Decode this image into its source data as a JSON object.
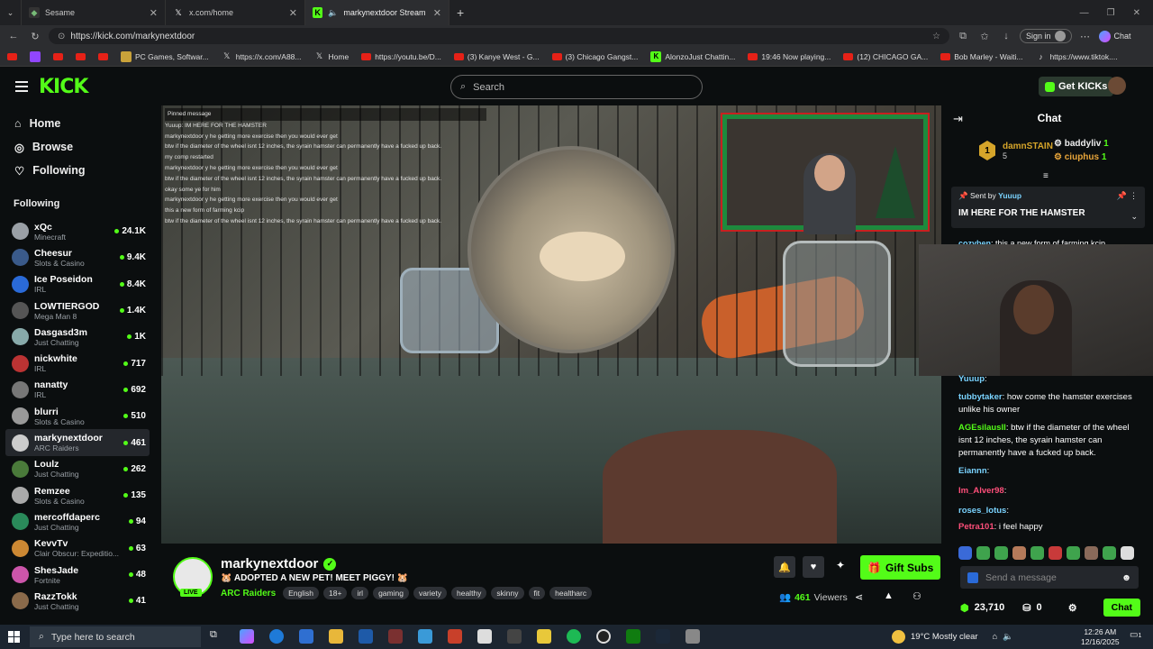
{
  "browser": {
    "tabs": [
      {
        "label": "Sesame"
      },
      {
        "label": "x.com/home"
      },
      {
        "label": "markynextdoor Stream - Wat..."
      }
    ],
    "url": "https://kick.com/markynextdoor",
    "signin_label": "Sign in",
    "copilot_label": "Chat",
    "bookmarks": [
      {
        "label": "PC Games, Softwar...",
        "icon": "game-icon"
      },
      {
        "label": "https://x.com/A88...",
        "icon": "x-icon"
      },
      {
        "label": "Home",
        "icon": "x-icon"
      },
      {
        "label": "https://youtu.be/D...",
        "icon": "youtube-icon"
      },
      {
        "label": "(3) Kanye West - G...",
        "icon": "youtube-icon"
      },
      {
        "label": "(3) Chicago Gangst...",
        "icon": "youtube-icon"
      },
      {
        "label": "AlonzoJust Chattin...",
        "icon": "kick-icon"
      },
      {
        "label": "19:46 Now playing...",
        "icon": "youtube-icon"
      },
      {
        "label": "(12) CHICAGO GA...",
        "icon": "youtube-icon"
      },
      {
        "label": "Bob Marley - Waiti...",
        "icon": "youtube-icon"
      },
      {
        "label": "https://www.tiktok....",
        "icon": "tiktok-icon"
      }
    ]
  },
  "kick": {
    "logo": "KICK",
    "search_placeholder": "Search",
    "get_kicks_label": "Get KICKs"
  },
  "sidebar": {
    "nav": [
      {
        "label": "Home",
        "icon": "home-icon"
      },
      {
        "label": "Browse",
        "icon": "compass-icon"
      },
      {
        "label": "Following",
        "icon": "heart-icon"
      }
    ],
    "following_title": "Following",
    "channels": [
      {
        "name": "xQc",
        "category": "Minecraft",
        "viewers": "24.1K",
        "color": "#9aa0a6"
      },
      {
        "name": "Cheesur",
        "category": "Slots & Casino",
        "viewers": "9.4K",
        "color": "#3a5a8a"
      },
      {
        "name": "Ice Poseidon",
        "category": "IRL",
        "viewers": "8.4K",
        "color": "#2a6ad8"
      },
      {
        "name": "LOWTIERGOD",
        "category": "Mega Man 8",
        "viewers": "1.4K",
        "color": "#555"
      },
      {
        "name": "Dasgasd3m",
        "category": "Just Chatting",
        "viewers": "1K",
        "color": "#8aa"
      },
      {
        "name": "nickwhite",
        "category": "IRL",
        "viewers": "717",
        "color": "#b33"
      },
      {
        "name": "nanatty",
        "category": "IRL",
        "viewers": "692",
        "color": "#777"
      },
      {
        "name": "blurri",
        "category": "Slots & Casino",
        "viewers": "510",
        "color": "#999"
      },
      {
        "name": "markynextdoor",
        "category": "ARC Raiders",
        "viewers": "461",
        "color": "#ccc",
        "selected": true
      },
      {
        "name": "Loulz",
        "category": "Just Chatting",
        "viewers": "262",
        "color": "#4a7a3a"
      },
      {
        "name": "Remzee",
        "category": "Slots & Casino",
        "viewers": "135",
        "color": "#aaa"
      },
      {
        "name": "mercoffdaperc",
        "category": "Just Chatting",
        "viewers": "94",
        "color": "#2a8a5a"
      },
      {
        "name": "KevvTv",
        "category": "Clair Obscur: Expeditio...",
        "viewers": "63",
        "color": "#c83"
      },
      {
        "name": "ShesJade",
        "category": "Fortnite",
        "viewers": "48",
        "color": "#c5a"
      },
      {
        "name": "RazzTokk",
        "category": "Just Chatting",
        "viewers": "41",
        "color": "#8a6a4a"
      }
    ]
  },
  "video": {
    "overlay_chat": [
      "Pinned message",
      "Yuuup: IM HERE FOR THE HAMSTER",
      "markynextdoor y he getting more exercise then you would ever get",
      "btw if the diameter of the wheel isnt 12 inches, the syrain hamster can permanently have a fucked up back.",
      "my comp restarted",
      "markynextdoor y he getting more exercise then you would ever get",
      "btw if the diameter of the wheel isnt 12 inches, the syrain hamster can permanently have a fucked up back.",
      "okay some ye for him",
      "markynextdoor y he getting more exercise then you would ever get",
      "this a new form of farming kcip",
      "btw if the diameter of the wheel isnt 12 inches, the syrain hamster can permanently have a fucked up back."
    ]
  },
  "stream": {
    "streamer": "markynextdoor",
    "live_label": "LIVE",
    "title": "🐹 ADOPTED A NEW PET! MEET PIGGY! 🐹",
    "category": "ARC Raiders",
    "tags": [
      "English",
      "18+",
      "irl",
      "gaming",
      "variety",
      "healthy",
      "skinny",
      "fit",
      "healtharc"
    ],
    "gift_subs_label": "Gift Subs",
    "viewers": "461",
    "viewers_label": "Viewers"
  },
  "chat": {
    "title": "Chat",
    "leaderboard": [
      {
        "rank": "1",
        "name": "damnSTAIN",
        "count": "5"
      },
      {
        "name": "baddyliv",
        "count": "1"
      },
      {
        "name": "ciuphus",
        "count": "1"
      }
    ],
    "pinned": {
      "sent_by_label": "Sent by",
      "sender": "Yuuup",
      "message": "IM HERE FOR THE HAMSTER"
    },
    "partial_message": {
      "user": "cozyben",
      "text": ": this a new form of farming kcip"
    },
    "messages": [
      {
        "user": "Yuuup",
        "text": ":",
        "color": "#7ad3ff"
      },
      {
        "user": "tubbytaker",
        "text": ": how come the hamster exercises unlike his owner",
        "color": "#7ad3ff"
      },
      {
        "user": "AGEsilausII",
        "text": ": btw if the diameter of the wheel isnt 12 inches, the syrain hamster can permanently have a fucked up back.",
        "color": "#53fc18"
      },
      {
        "user": "Eiannn",
        "text": ":",
        "color": "#7ad3ff"
      },
      {
        "user": "Im_Alver98",
        "text": ":",
        "color": "#ff4f7a"
      },
      {
        "user": "roses_lotus",
        "text": ":",
        "color": "#7ad3ff"
      },
      {
        "user": "Petra101",
        "text": ": i feel happy",
        "color": "#ff4f7a"
      }
    ],
    "input_placeholder": "Send a message",
    "points": "23,710",
    "second_count": "0",
    "chat_button": "Chat"
  },
  "taskbar": {
    "search_placeholder": "Type here to search",
    "weather": "19°C  Mostly clear",
    "time": "12:26 AM",
    "date": "12/16/2025",
    "notifications": "1"
  }
}
